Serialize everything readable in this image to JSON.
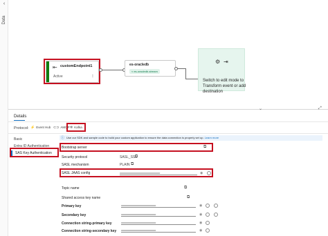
{
  "rail": {
    "label": "Data"
  },
  "canvas": {
    "source_node": {
      "title": "customEndpoint1",
      "status": "Active"
    },
    "stream_node": {
      "title": "es-oracledb",
      "chip": "es-oracledb-stream"
    },
    "destination_node": {
      "text": "Switch to edit mode to Transform event or add destination"
    }
  },
  "details": {
    "tab": "Details",
    "protocol_label": "Protocol:",
    "protocols": [
      "Event Hub",
      "AMQP",
      "Kafka"
    ],
    "selected_protocol": "Kafka",
    "info": {
      "text": "Use our SDK and sample code to build your custom application to ensure the data connection is properly set up.",
      "link": "Learn more"
    },
    "nav": [
      "Basic",
      "Entra ID Authentication",
      "SAS Key Authentication"
    ],
    "selected_nav": "SAS Key Authentication",
    "fields": {
      "bootstrap_server": {
        "label": "Bootstrap server"
      },
      "security_protocol": {
        "label": "Security protocol",
        "value": "SASL_SSL"
      },
      "sasl_mechanism": {
        "label": "SASL mechanism",
        "value": "PLAIN"
      },
      "sasl_jaas": {
        "label": "SASL JAAS config",
        "value": "••••••••••••••••••••••••••••••••••••••••••••••••••••••••••"
      },
      "topic_name": {
        "label": "Topic name"
      },
      "shared_access_key_name": {
        "label": "Shared access key name"
      },
      "primary_key": {
        "label": "Primary key",
        "value": "••••••••••••••••••••••••••••••••••••••••••••••••••"
      },
      "secondary_key": {
        "label": "Secondary key",
        "value": "••••••••••••••••••••••••••••••••••••••••••••••••••"
      },
      "conn_primary": {
        "label": "Connection string-primary key",
        "value": "••••••••••••••••••••••••••••••••••••••••••••••••••"
      },
      "conn_secondary": {
        "label": "Connection string-secondary key",
        "value": "••••••••••••••••••••••••••••••••••••••••••••••••••"
      }
    }
  },
  "colors": {
    "accent": "#0f6cbd",
    "highlight": "#c50f1f",
    "active": "#107c10"
  },
  "icons": {
    "copy": "copy-icon",
    "eye": "eye-icon",
    "refresh": "refresh-icon",
    "kafka": "kafka-icon",
    "info": "info-icon"
  }
}
